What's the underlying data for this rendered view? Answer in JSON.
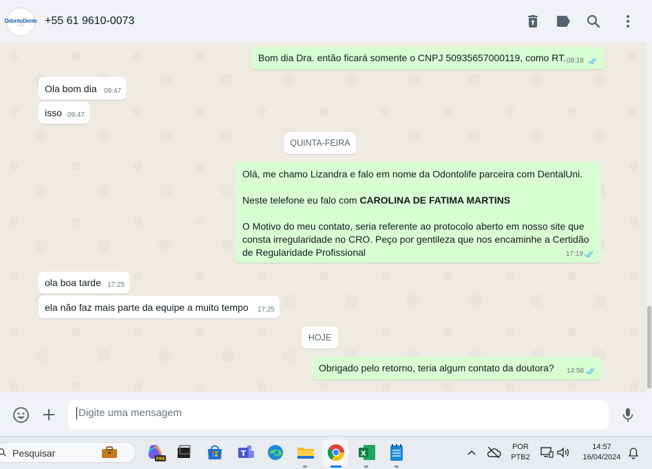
{
  "header": {
    "contact_name": "+55 61 9610-0073",
    "avatar_logo": "OdontoDente",
    "icons": [
      "delete-icon",
      "label-icon",
      "search-icon",
      "menu-icon"
    ]
  },
  "day_chips": {
    "thursday": "QUINTA-FEIRA",
    "today": "HOJE"
  },
  "messages": [
    {
      "dir": "out",
      "text": "Bom dia Dra. então ficará somente o CNPJ 50935657000119, como RT.",
      "time": "08:18"
    },
    {
      "dir": "in",
      "text": "Ola bom dia",
      "time": "09:47"
    },
    {
      "dir": "in",
      "text": "isso",
      "time": "09:47"
    },
    {
      "dir": "out",
      "line1": "Olá, me chamo Lizandra e falo em nome da Odontolife parceira com DentalUni.",
      "line2_prefix": "Neste telefone eu falo com ",
      "line2_bold": "CAROLINA DE FATIMA MARTINS",
      "line3a": "O Motivo do meu contato, seria referente ao protocolo aberto em nosso site que",
      "line3b": "consta irregularidade no CRO. Peço por gentileza que nos encaminhe a Certidão",
      "line3c": "de Regularidade Profissional",
      "time": "17:19"
    },
    {
      "dir": "in",
      "text": "ola boa tarde",
      "time": "17:25"
    },
    {
      "dir": "in",
      "text": "ela não faz mais parte da equipe a muito tempo",
      "time": "17:25"
    },
    {
      "dir": "out",
      "text": "Obrigado pelo retorno, teria algum contato da doutora?",
      "time": "14:58"
    }
  ],
  "composer": {
    "placeholder": "Digite uma mensagem",
    "icons": [
      "emoji-icon",
      "plus-icon",
      "mic-icon"
    ]
  },
  "taskbar": {
    "search_label": "Pesquisar",
    "copilot_badge": "PRE",
    "language_top": "POR",
    "language_bottom": "PTB2",
    "time": "14:57",
    "date": "16/04/2024"
  },
  "colors": {
    "outgoing_bubble": "#d9fdd3",
    "incoming_bubble": "#ffffff",
    "chat_background": "#efeae2",
    "read_ticks": "#53bdeb"
  }
}
